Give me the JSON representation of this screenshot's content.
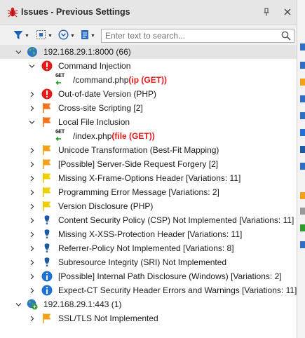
{
  "window": {
    "title": "Issues - Previous Settings"
  },
  "toolbar": {
    "search_placeholder": "Enter text to search..."
  },
  "colors": {
    "critical": "#e31b1b",
    "high": "#f5731f",
    "medium": "#f5a21b",
    "low": "#f0d000",
    "info": "#2272d6",
    "best_practice": "#1f5aa5"
  },
  "hosts": [
    {
      "label": "192.168.29.1:8000 (66)",
      "expanded": true,
      "issues": [
        {
          "label": "Command Injection",
          "severity": "critical",
          "icon": "critical-icon",
          "expanded": true,
          "request": {
            "path": "/command.php ",
            "param": "(ip (GET))"
          }
        },
        {
          "label": "Out-of-date Version (PHP)",
          "severity": "critical",
          "icon": "critical-icon"
        },
        {
          "label": "Cross-site Scripting [2]",
          "severity": "high",
          "icon": "high-flag-icon"
        },
        {
          "label": "Local File Inclusion",
          "severity": "high",
          "icon": "high-flag-icon",
          "expanded": true,
          "request": {
            "path": "/index.php ",
            "param": "(file (GET))"
          }
        },
        {
          "label": "Unicode Transformation (Best-Fit Mapping)",
          "severity": "medium",
          "icon": "medium-flag-icon"
        },
        {
          "label": "[Possible] Server-Side Request Forgery [2]",
          "severity": "medium",
          "icon": "medium-flag-icon"
        },
        {
          "label": "Missing X-Frame-Options Header [Variations: 11]",
          "severity": "low",
          "icon": "low-flag-icon"
        },
        {
          "label": "Programming Error Message [Variations: 2]",
          "severity": "low",
          "icon": "low-flag-icon"
        },
        {
          "label": "Version Disclosure (PHP)",
          "severity": "low",
          "icon": "low-flag-icon"
        },
        {
          "label": "Content Security Policy (CSP) Not Implemented [Variations: 11]",
          "severity": "best_practice",
          "icon": "best-practice-icon"
        },
        {
          "label": "Missing X-XSS-Protection Header [Variations: 11]",
          "severity": "best_practice",
          "icon": "best-practice-icon"
        },
        {
          "label": "Referrer-Policy Not Implemented [Variations: 8]",
          "severity": "best_practice",
          "icon": "best-practice-icon"
        },
        {
          "label": "Subresource Integrity (SRI) Not Implemented",
          "severity": "best_practice",
          "icon": "best-practice-icon"
        },
        {
          "label": "[Possible] Internal Path Disclosure (Windows) [Variations: 2]",
          "severity": "info",
          "icon": "info-icon"
        },
        {
          "label": "Expect-CT Security Header Errors and Warnings [Variations: 11]",
          "severity": "info",
          "icon": "info-icon"
        }
      ]
    },
    {
      "label": "192.168.29.1:443 (1)",
      "expanded": true,
      "issues": [
        {
          "label": "SSL/TLS Not Implemented",
          "severity": "medium",
          "icon": "medium-flag-icon"
        }
      ]
    }
  ]
}
